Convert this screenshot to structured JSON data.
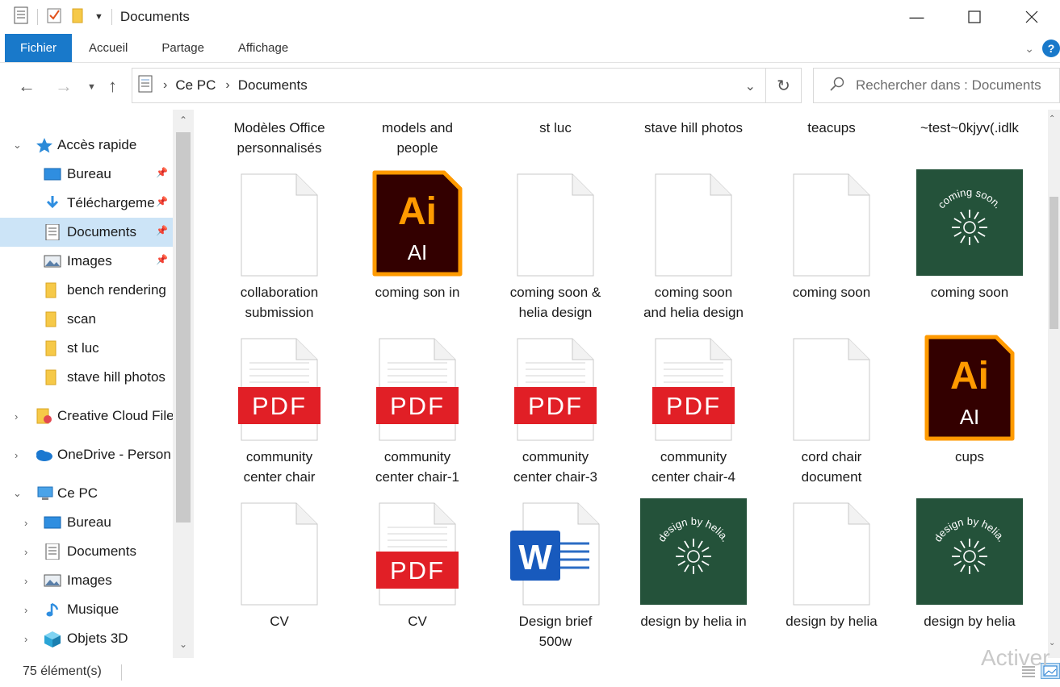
{
  "window": {
    "title": "Documents"
  },
  "ribbon": {
    "tabs": [
      "Fichier",
      "Accueil",
      "Partage",
      "Affichage"
    ]
  },
  "address": {
    "crumbs": [
      "Ce PC",
      "Documents"
    ]
  },
  "search": {
    "placeholder": "Rechercher dans : Documents"
  },
  "sidebar": {
    "items": [
      {
        "label": "Accès rapide"
      },
      {
        "label": "Bureau"
      },
      {
        "label": "Téléchargeme"
      },
      {
        "label": "Documents"
      },
      {
        "label": "Images"
      },
      {
        "label": "bench rendering"
      },
      {
        "label": "scan"
      },
      {
        "label": "st luc"
      },
      {
        "label": "stave hill photos"
      },
      {
        "label": "Creative Cloud File"
      },
      {
        "label": "OneDrive - Person"
      },
      {
        "label": "Ce PC"
      },
      {
        "label": "Bureau"
      },
      {
        "label": "Documents"
      },
      {
        "label": "Images"
      },
      {
        "label": "Musique"
      },
      {
        "label": "Objets 3D"
      }
    ]
  },
  "files": [
    {
      "l1": "Modèles Office",
      "l2": "personnalisés",
      "kind": "folder-cut"
    },
    {
      "l1": "models and",
      "l2": "people",
      "kind": "folder-cut"
    },
    {
      "l1": "st luc",
      "l2": "",
      "kind": "folder-cut"
    },
    {
      "l1": "stave hill photos",
      "l2": "",
      "kind": "folder-cut"
    },
    {
      "l1": "teacups",
      "l2": "",
      "kind": "folder-cut"
    },
    {
      "l1": "~test~0kjyv(.idlk",
      "l2": "",
      "kind": "folder-cut"
    },
    {
      "l1": "collaboration",
      "l2": "submission",
      "kind": "blank"
    },
    {
      "l1": "coming son in",
      "l2": "",
      "kind": "ai",
      "ai_big": "Ai",
      "ai_small": "AI"
    },
    {
      "l1": "coming soon &",
      "l2": "helia design",
      "kind": "blank"
    },
    {
      "l1": "coming soon",
      "l2": "and helia design",
      "kind": "blank"
    },
    {
      "l1": "coming soon",
      "l2": "",
      "kind": "blank"
    },
    {
      "l1": "coming soon",
      "l2": "",
      "kind": "green",
      "green_text": "coming soon."
    },
    {
      "l1": "community",
      "l2": "center chair",
      "kind": "pdf",
      "pdf": "PDF"
    },
    {
      "l1": "community",
      "l2": "center chair-1",
      "kind": "pdf",
      "pdf": "PDF"
    },
    {
      "l1": "community",
      "l2": "center chair-3",
      "kind": "pdf",
      "pdf": "PDF"
    },
    {
      "l1": "community",
      "l2": "center chair-4",
      "kind": "pdf",
      "pdf": "PDF"
    },
    {
      "l1": "cord chair",
      "l2": "document",
      "kind": "blank"
    },
    {
      "l1": "cups",
      "l2": "",
      "kind": "ai",
      "ai_big": "Ai",
      "ai_small": "AI"
    },
    {
      "l1": "CV",
      "l2": "",
      "kind": "blank"
    },
    {
      "l1": "CV",
      "l2": "",
      "kind": "pdf",
      "pdf": "PDF"
    },
    {
      "l1": "Design brief",
      "l2": "500w",
      "kind": "word",
      "word": "W"
    },
    {
      "l1": "design by helia in",
      "l2": "",
      "kind": "green",
      "green_text": "design by helia."
    },
    {
      "l1": "design by helia",
      "l2": "",
      "kind": "blank"
    },
    {
      "l1": "design by helia",
      "l2": "",
      "kind": "green",
      "green_text": "design by helia."
    }
  ],
  "status": {
    "count": "75 élément(s)"
  },
  "watermark": "Activer",
  "colors": {
    "accent": "#1979ca",
    "pdf_red": "#e11f26",
    "ai_bg": "#330000",
    "ai_orange": "#ff9a00",
    "green_tile": "#24523a",
    "selected": "#cce4f7"
  }
}
